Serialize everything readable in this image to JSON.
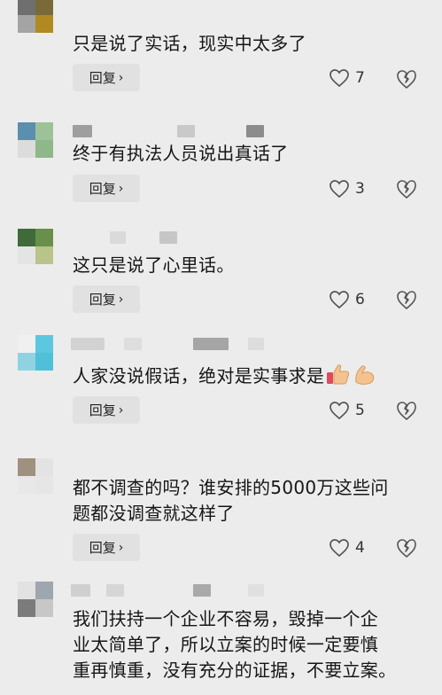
{
  "ui": {
    "reply_label": "回复",
    "reply_chevron": "›"
  },
  "comments": [
    {
      "text": "只是说了实话，现实中太多了",
      "likes": "7"
    },
    {
      "text": "终于有执法人员说出真话了",
      "likes": "3"
    },
    {
      "text": "这只是说了心里话。",
      "likes": "6"
    },
    {
      "text": "人家没说假话，绝对是实事求是",
      "likes": "5",
      "emojis": [
        "thumbs-up-icon",
        "flexed-biceps-icon"
      ]
    },
    {
      "text_lines": [
        "都不调查的吗？谁安排的5000万这些问",
        "题都没调查就这样了"
      ],
      "likes": "4"
    },
    {
      "text_lines": [
        "我们扶持一个企业不容易，毁掉一个企",
        "业太简单了，所以立案的时候一定要慎",
        "重再慎重，没有充分的证据，不要立案。"
      ]
    }
  ],
  "colors": {
    "background": "#ececec",
    "reply_bg": "#e1e1e1",
    "icon": "#555555"
  }
}
